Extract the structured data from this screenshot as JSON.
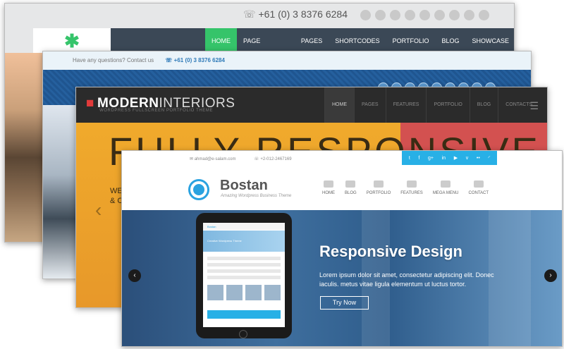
{
  "card1": {
    "phone": "+61 (0) 3 8376 6284",
    "menu": [
      "HOME",
      "PAGE BUILDER",
      "PAGES",
      "SHORTCODES",
      "PORTFOLIO",
      "BLOG",
      "SHOWCASE"
    ]
  },
  "card2": {
    "question": "Have any questions? Contact us",
    "phone": "+61 (0) 3 8376 6284"
  },
  "card3": {
    "brand_bold": "MODERN",
    "brand_thin": "INTERIORS",
    "tagline": "WORDPRESS FULLSCREEN PORTFOLIO THEME",
    "menu": [
      "HOME",
      "PAGES",
      "FEATURES",
      "PORTFOLIO",
      "BLOG",
      "CONTACTS"
    ],
    "hero": "FULLY RESPONSIVE",
    "sub1": "WE",
    "sub2": "& C"
  },
  "card4": {
    "email": "ahmad@e-salam.com",
    "phone": "+2-012-2467169",
    "brand": "Bostan",
    "brand_tag": "Amazing Wordpress Business Theme",
    "nav": [
      "HOME",
      "BLOG",
      "PORTFOLIO",
      "FEATURES",
      "MEGA MENU",
      "CONTACT"
    ],
    "tablet_brand": "Bostan",
    "tablet_hero": "Creative Wordpress Theme",
    "headline": "Responsive Design",
    "body": "Lorem ipsum dolor sit amet, consectetur adipiscing elit. Donec iaculis. metus vitae ligula elementum ut luctus tortor.",
    "cta": "Try Now"
  },
  "colors": {
    "accent_green": "#35c46a",
    "accent_blue": "#28b0e6",
    "accent_red": "#d35150",
    "hero_orange": "#f2a830"
  }
}
